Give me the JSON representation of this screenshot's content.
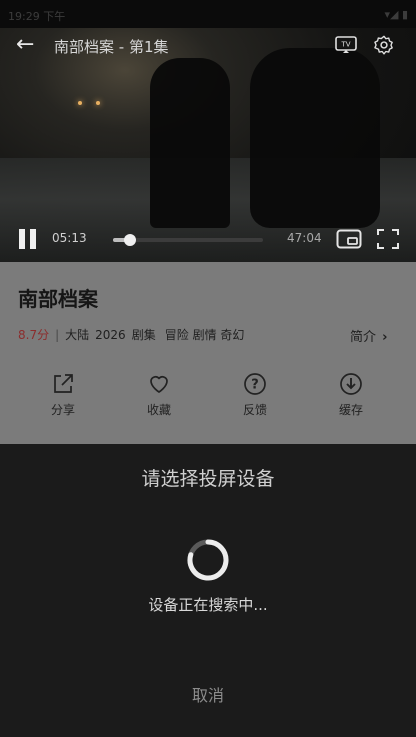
{
  "status_bar": {
    "time": "19:29 下午",
    "right": "▾◢ ▮"
  },
  "player": {
    "title": "南部档案 - 第1集",
    "current_time": "05:13",
    "total_time": "47:04",
    "progress_fraction": 0.11
  },
  "show": {
    "title": "南部档案",
    "rating": "8.7分",
    "region": "大陆",
    "year": "2026",
    "type": "剧集",
    "genres": [
      "冒险",
      "剧情",
      "奇幻"
    ],
    "intro_label": "简介"
  },
  "actions": [
    {
      "label": "分享",
      "icon": "share-icon"
    },
    {
      "label": "收藏",
      "icon": "heart-icon"
    },
    {
      "label": "反馈",
      "icon": "question-icon"
    },
    {
      "label": "缓存",
      "icon": "download-icon"
    }
  ],
  "cast_sheet": {
    "title": "请选择投屏设备",
    "status": "设备正在搜索中...",
    "cancel_label": "取消"
  }
}
